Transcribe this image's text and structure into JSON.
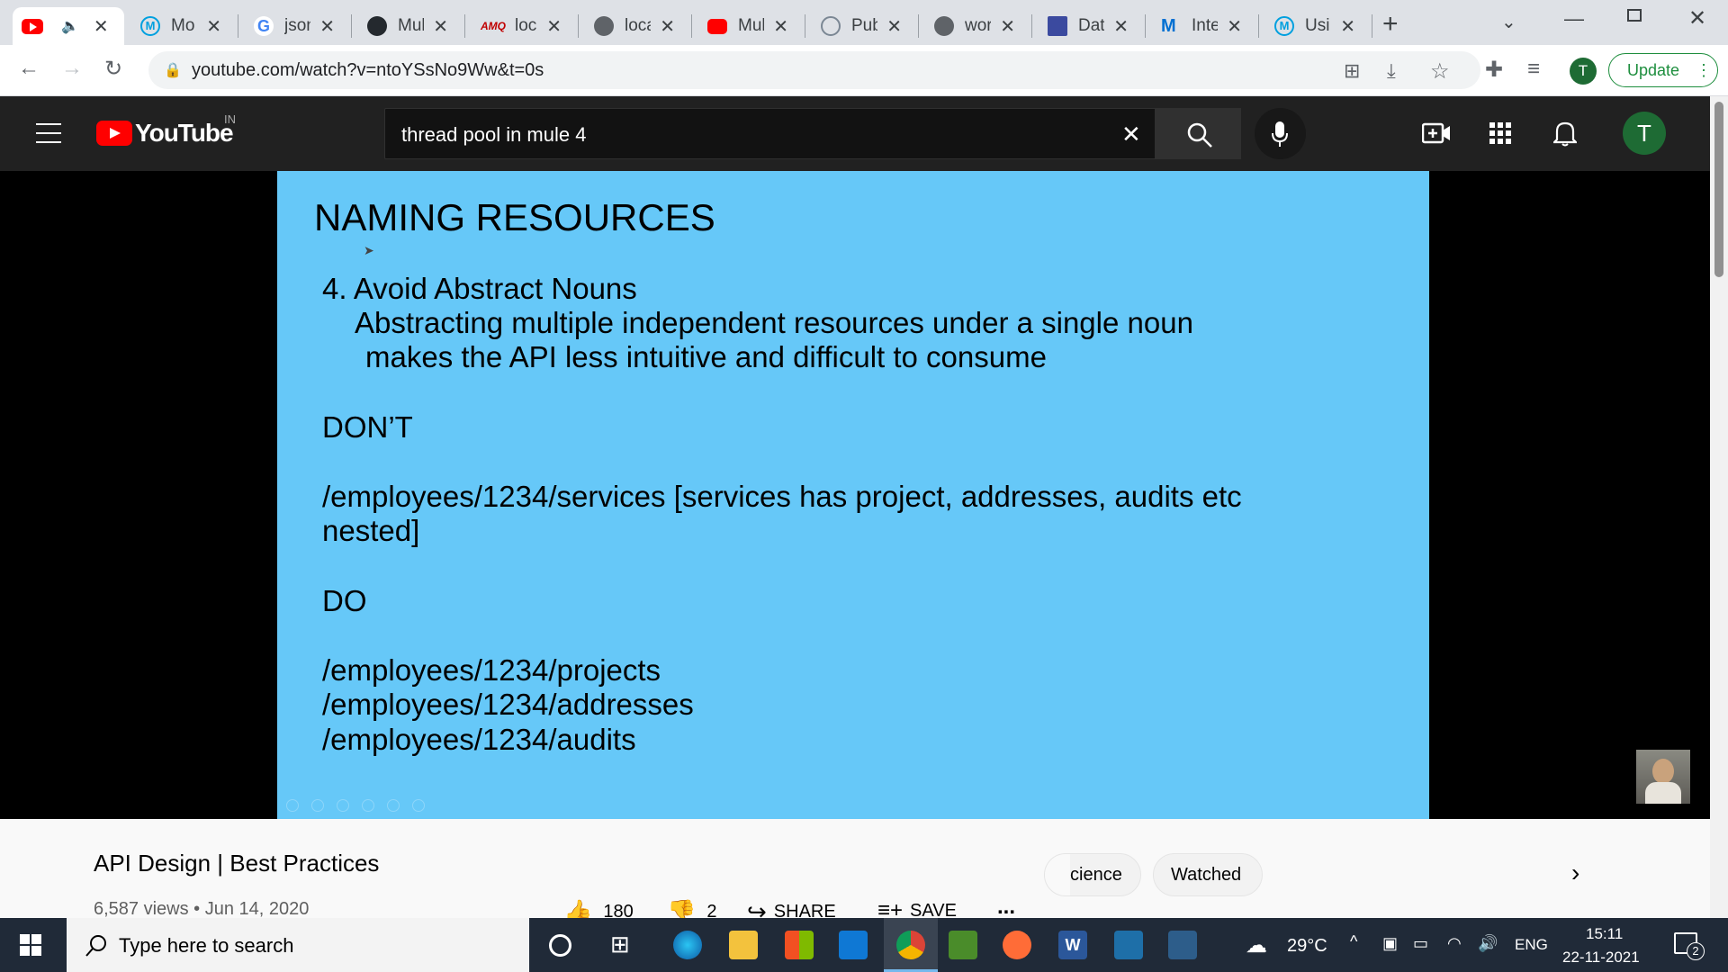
{
  "browser": {
    "tabs": [
      {
        "title": "",
        "icon": "youtube-icon",
        "color": "#ff0000",
        "active": true
      },
      {
        "title": "Mo",
        "icon": "mulesoft-icon",
        "color": "#00a0df"
      },
      {
        "title": "json",
        "icon": "google-icon",
        "color": "#4285f4"
      },
      {
        "title": "Mul",
        "icon": "github-icon",
        "color": "#24292e"
      },
      {
        "title": "loca",
        "icon": "amq-icon",
        "color": "#c00000"
      },
      {
        "title": "loca",
        "icon": "globe-icon",
        "color": "#5f6368"
      },
      {
        "title": "Mul",
        "icon": "youtube-icon",
        "color": "#ff0000"
      },
      {
        "title": "Pub",
        "icon": "puzzle-icon",
        "color": "#7b8794"
      },
      {
        "title": "wor",
        "icon": "globe-icon",
        "color": "#5f6368"
      },
      {
        "title": "Dat",
        "icon": "dataweave-icon",
        "color": "#3b4a9f"
      },
      {
        "title": "Inte",
        "icon": "mulesoft-mountain-icon",
        "color": "#0070d2"
      },
      {
        "title": "Usi",
        "icon": "mulesoft-icon",
        "color": "#00a0df"
      }
    ],
    "url": "youtube.com/watch?v=ntoYSsNo9Ww&t=0s",
    "profile_initial": "T",
    "update_label": "Update"
  },
  "youtube": {
    "logo_text": "YouTube",
    "region": "IN",
    "search_value": "thread pool in mule 4",
    "avatar_initial": "T"
  },
  "slide": {
    "title": "NAMING RESOURCES",
    "point_heading": "4. Avoid Abstract Nouns",
    "point_line1": "Abstracting multiple independent resources under a single noun",
    "point_line2": "makes the API less intuitive and difficult to consume",
    "dont_label": "DON’T",
    "dont_example_line1": "/employees/1234/services [services has project, addresses, audits etc",
    "dont_example_line2": "nested]",
    "do_label": "DO",
    "do_examples": [
      "/employees/1234/projects",
      "/employees/1234/addresses",
      "/employees/1234/audits"
    ]
  },
  "video_info": {
    "title": "API Design | Best Practices",
    "meta": "6,587 views • Jun 14, 2020",
    "likes": "180",
    "dislikes": "2",
    "share_label": "SHARE",
    "save_label": "SAVE",
    "more_label": "..."
  },
  "chips": [
    "cience",
    "Watched"
  ],
  "taskbar": {
    "search_placeholder": "Type here to search",
    "temperature": "29°C",
    "language": "ENG",
    "time": "15:11",
    "date": "22-11-2021",
    "notification_count": "2"
  }
}
